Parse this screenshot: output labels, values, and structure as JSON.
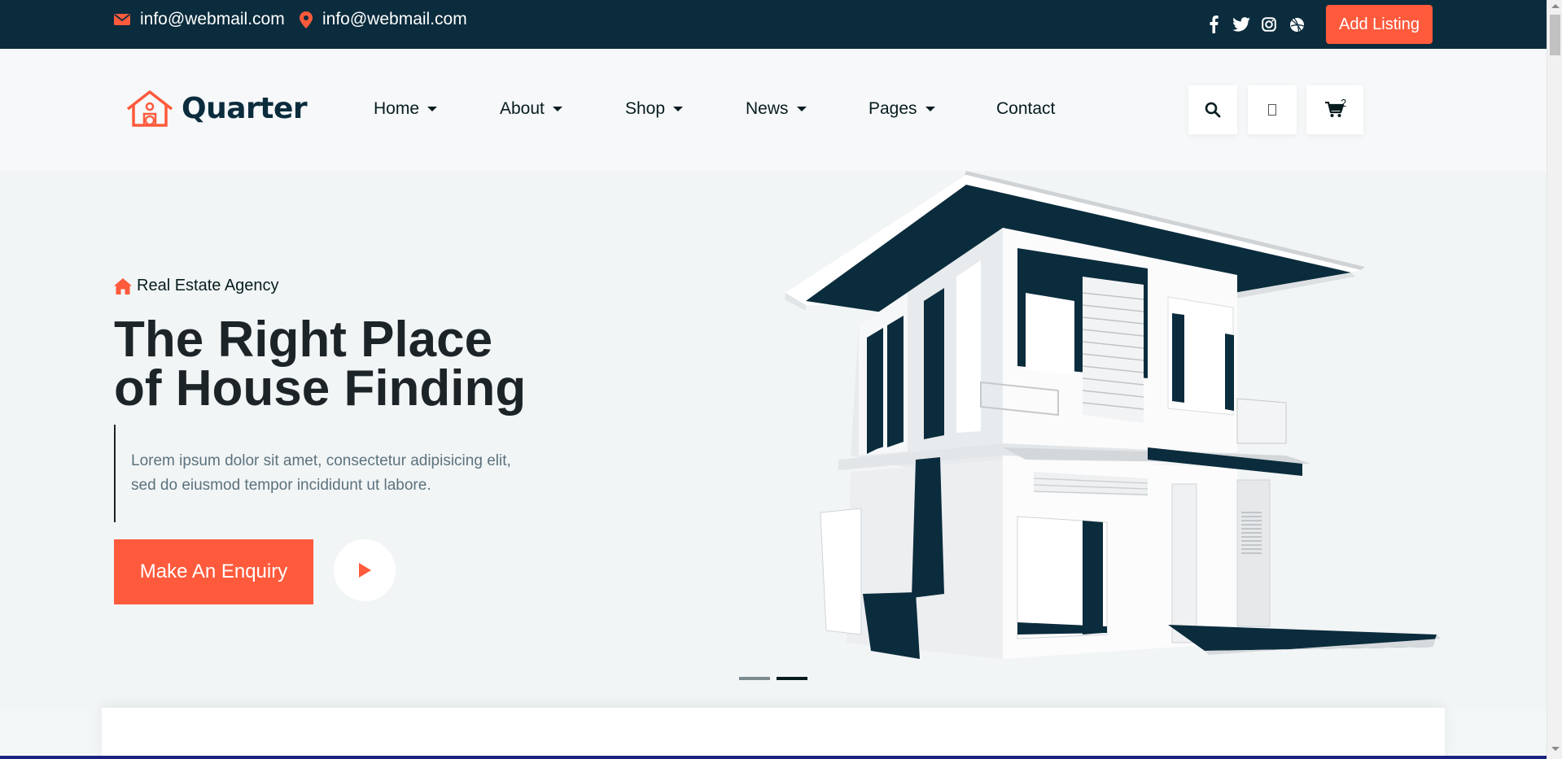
{
  "topbar": {
    "email": "info@webmail.com",
    "location": "info@webmail.com",
    "social_icons": [
      "facebook-icon",
      "twitter-icon",
      "instagram-icon",
      "dribbble-icon"
    ],
    "add_listing_label": "Add Listing"
  },
  "header": {
    "logo_text": "Quarter",
    "nav": [
      {
        "label": "Home",
        "has_dropdown": true
      },
      {
        "label": "About",
        "has_dropdown": true
      },
      {
        "label": "Shop",
        "has_dropdown": true
      },
      {
        "label": "News",
        "has_dropdown": true
      },
      {
        "label": "Pages",
        "has_dropdown": true
      },
      {
        "label": "Contact",
        "has_dropdown": false
      }
    ],
    "cart_count": "2"
  },
  "hero": {
    "subtitle": "Real Estate Agency",
    "title": "The Right Place\nof House Finding",
    "description": "Lorem ipsum dolor sit amet, consectetur adipisicing elit,\nsed do eiusmod tempor incididunt ut labore.",
    "cta_label": "Make An Enquiry",
    "slides": 2,
    "active_slide": 2
  },
  "colors": {
    "accent": "#ff5a3c",
    "dark": "#0b2c3d",
    "heading": "#1d2428",
    "background": "#f2f5f6"
  }
}
